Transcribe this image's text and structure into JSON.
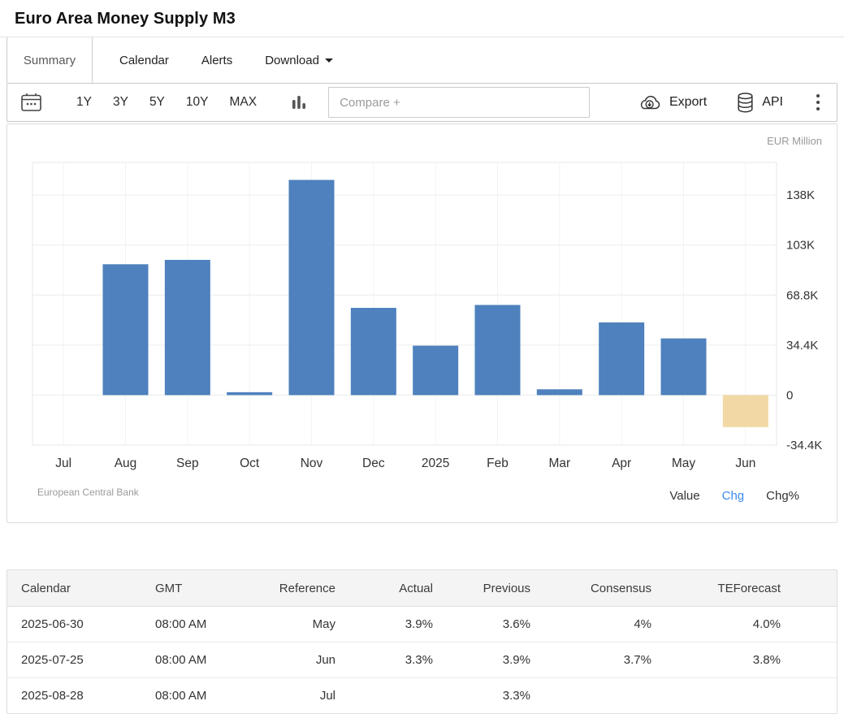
{
  "header": {
    "title": "Euro Area Money Supply M3"
  },
  "tabs": [
    {
      "label": "Summary",
      "active": true
    },
    {
      "label": "Calendar",
      "active": false
    },
    {
      "label": "Alerts",
      "active": false
    },
    {
      "label": "Download",
      "active": false,
      "has_caret": true
    }
  ],
  "toolbar": {
    "ranges": [
      "1Y",
      "3Y",
      "5Y",
      "10Y",
      "MAX"
    ],
    "compare_placeholder": "Compare +",
    "export_label": "Export",
    "api_label": "API",
    "icons": [
      "calendar-icon",
      "bar-chart-icon",
      "cloud-download-icon",
      "database-icon",
      "kebab-menu-icon"
    ]
  },
  "chart_data": {
    "type": "bar",
    "title": "Euro Area Money Supply M3",
    "unit_label": "EUR Million",
    "categories": [
      "Jul",
      "Aug",
      "Sep",
      "Oct",
      "Nov",
      "Dec",
      "2025",
      "Feb",
      "Mar",
      "Apr",
      "May",
      "Jun"
    ],
    "values": [
      0,
      90000,
      93000,
      2000,
      148000,
      60000,
      34000,
      62000,
      4000,
      50000,
      39000,
      -22000
    ],
    "forecast_index": 11,
    "bar_color": "#4e81bd",
    "forecast_color": "#f2d8a4",
    "ylim": [
      -34400,
      160000
    ],
    "yticks": [
      {
        "value": 137600,
        "label": "138K"
      },
      {
        "value": 103200,
        "label": "103K"
      },
      {
        "value": 68800,
        "label": "68.8K"
      },
      {
        "value": 34400,
        "label": "34.4K"
      },
      {
        "value": 0,
        "label": "0"
      },
      {
        "value": -34400,
        "label": "-34.4K"
      }
    ],
    "grid": true,
    "legend_position": "none",
    "source": "European Central Bank",
    "toggles": [
      "Value",
      "Chg",
      "Chg%"
    ],
    "active_toggle": "Chg"
  },
  "table": {
    "headers": [
      "Calendar",
      "GMT",
      "Reference",
      "Actual",
      "Previous",
      "Consensus",
      "TEForecast"
    ],
    "rows": [
      [
        "2025-06-30",
        "08:00 AM",
        "May",
        "3.9%",
        "3.6%",
        "4%",
        "4.0%"
      ],
      [
        "2025-07-25",
        "08:00 AM",
        "Jun",
        "3.3%",
        "3.9%",
        "3.7%",
        "3.8%"
      ],
      [
        "2025-08-28",
        "08:00 AM",
        "Jul",
        "",
        "3.3%",
        "",
        ""
      ]
    ]
  },
  "colors": {
    "accent_blue": "#3b8af2",
    "bar_blue": "#4e81bd",
    "forecast_beige": "#f2d8a4",
    "muted_text": "#9a9a9a"
  }
}
